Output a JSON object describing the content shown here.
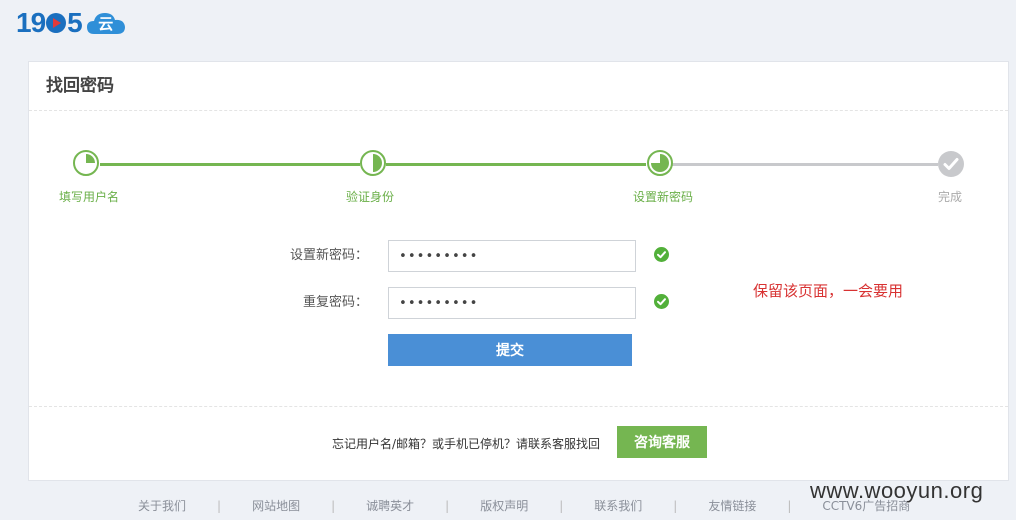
{
  "logo": {
    "text_pre": "19",
    "text_post": "5",
    "cloud": "云"
  },
  "card": {
    "title": "找回密码",
    "steps": [
      {
        "label": "填写用户名",
        "state": "done"
      },
      {
        "label": "验证身份",
        "state": "done"
      },
      {
        "label": "设置新密码",
        "state": "current"
      },
      {
        "label": "完成",
        "state": "pending"
      }
    ],
    "form": {
      "new_password_label": "设置新密码：",
      "new_password_value": "•••••••••",
      "confirm_password_label": "重复密码：",
      "confirm_password_value": "•••••••••",
      "submit_label": "提交"
    },
    "note": "保留该页面，一会要用",
    "footer": {
      "hint": "忘记用户名/邮箱？或手机已停机？请联系客服找回",
      "consult_label": "咨询客服"
    }
  },
  "bottom_links": [
    "关于我们",
    "网站地图",
    "诚聘英才",
    "版权声明",
    "联系我们",
    "友情链接",
    "CCTV6广告招商"
  ],
  "watermark": "www.wooyun.org",
  "colors": {
    "accent_green": "#75b651",
    "accent_blue": "#4a8fd6",
    "brand_blue": "#1a6fbf",
    "note_red": "#d83232"
  }
}
